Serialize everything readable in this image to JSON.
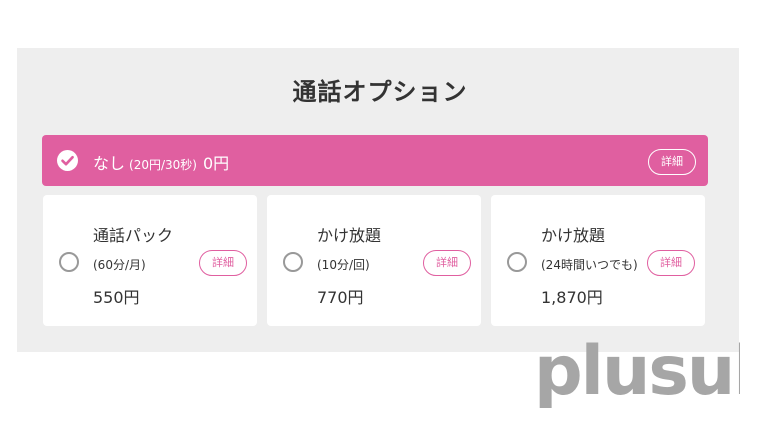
{
  "section_title": "通話オプション",
  "selected_option": {
    "label": "なし",
    "note": "(20円/30秒)",
    "price": "0円",
    "detail_label": "詳細"
  },
  "options": [
    {
      "name": "通話パック",
      "sub": "(60分/月)",
      "price": "550円",
      "detail_label": "詳細"
    },
    {
      "name": "かけ放題",
      "sub": "(10分/回)",
      "price": "770円",
      "detail_label": "詳細"
    },
    {
      "name": "かけ放題",
      "sub": "(24時間いつでも)",
      "price": "1,870円",
      "detail_label": "詳細"
    }
  ],
  "watermark": "plusul",
  "colors": {
    "accent": "#e05fa0",
    "panel_bg": "#eeeeee",
    "card_bg": "#ffffff",
    "text": "#333333",
    "watermark": "#a6a6a6"
  },
  "icons": {
    "selected": "check-circle-icon",
    "unselected": "radio-empty-icon"
  }
}
